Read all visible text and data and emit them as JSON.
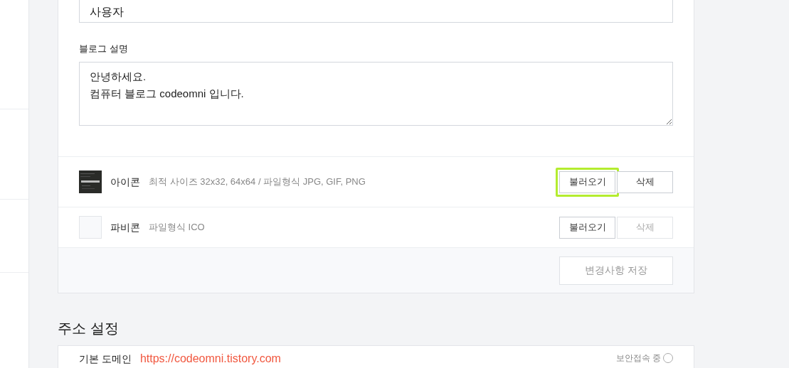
{
  "profile_card": {
    "name_field": {
      "value": "사용자"
    },
    "description": {
      "label": "블로그 설명",
      "value": "안녕하세요.\n컴퓨터 블로그 codeomni 입니다."
    },
    "image_rows": [
      {
        "kind": "picture",
        "title": "아이콘",
        "hint": "최적 사이즈 32x32, 64x64 / 파일형식 JPG, GIF, PNG",
        "buttons": [
          {
            "label": "불러오기",
            "disabled": false,
            "highlighted": true
          },
          {
            "label": "삭제",
            "disabled": false,
            "highlighted": false
          }
        ]
      },
      {
        "kind": "empty",
        "title": "파비콘",
        "hint": "파일형식 ICO",
        "buttons": [
          {
            "label": "불러오기",
            "disabled": false,
            "highlighted": false
          },
          {
            "label": "삭제",
            "disabled": true,
            "highlighted": false
          }
        ]
      }
    ],
    "save_button": {
      "label": "변경사항 저장",
      "disabled": true
    }
  },
  "address_section": {
    "title": "주소 설정",
    "domain_label": "기본 도메인",
    "domain_url": "https://codeomni.tistory.com",
    "secure_label": "보안접속 중"
  }
}
